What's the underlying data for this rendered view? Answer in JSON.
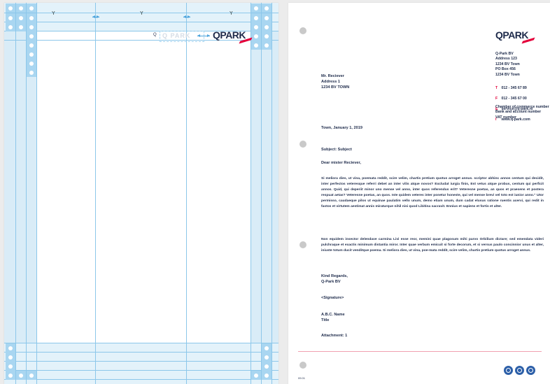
{
  "grid_page": {
    "column_labels": [
      "Y",
      "Y",
      "Y"
    ],
    "logo_marker": "Q",
    "logo_ghost": "Q PARK",
    "logo": "QPARK"
  },
  "letter": {
    "logo": "QPARK",
    "sender": "Q-Park BV\nAddress 123\n1234 BV Town\nPO Box 456\n1234 BV Town",
    "contact_keys": [
      "T",
      "F",
      "E",
      "I"
    ],
    "contact_values": [
      "012 - 345 67 89",
      "012 - 345 67 00",
      "service@q-park.nl",
      "www.q-park.com"
    ],
    "company_info": "Chamber of commerce number\nBank and account number\nVAT number",
    "recipient": "Mr. Reciever\nAddress 1\n1234 BV TOWN",
    "date": "Town, January 1, 2019",
    "subject": "Subject: Subject",
    "salutation": "Dear mister Reciever,",
    "paragraph1": "Si meliora dies, ut vina, poemata reddit, scire velim, chartis pretium quotus arroget annus. scriptor abhinc annos centum qui decidit, inter perfectos veteresque referri debet an inter vilis atque novos? Excludat iurgia finis, Est vetus atque probus, centum qui perficit annos. Quid, qui deperiit minor uno mense vel anno, inter quos referendus erit? Veteresne poetas, an quos et praesens et postera respuat aetas? Veteresne poetas, an quos. Iste quidem veteres inter ponetur honeste, qui vel mense brevi vel toto est iunior anno.\" Utor permisso, caudaeque pilos ut equinae paulatim vello unum, demo etiam unum, dum cadat elusus ratione ruentis acervi, qui redit in fastos et virtutem aestimat annis miraturque nihil nisi quod Libitina sacravit. Ennius et sapiens et fortis et alter.",
    "paragraph2": "Non equidem insector delendave carmina Livi esse reor, memini quae plagosum mihi parvo Orbilium dictare; sed emendata videri pulchraque et exactis minimum distantia miror. Inter quae verbum emicuit si forte decorum, et si versus paulo concinnior unus et alter, iniuste totum ducit venditque poema. Si meliora dies, ut vina, poe-mata reddit, scire velim, chartis pretium quotus arroget annus.",
    "closing": "Kind Regards,\nQ-Park BV",
    "signature": "<Signature>",
    "signer": "A.B.C. Name\nTitle",
    "attachment": "Attachment: 1",
    "footer_code": "09.01"
  }
}
